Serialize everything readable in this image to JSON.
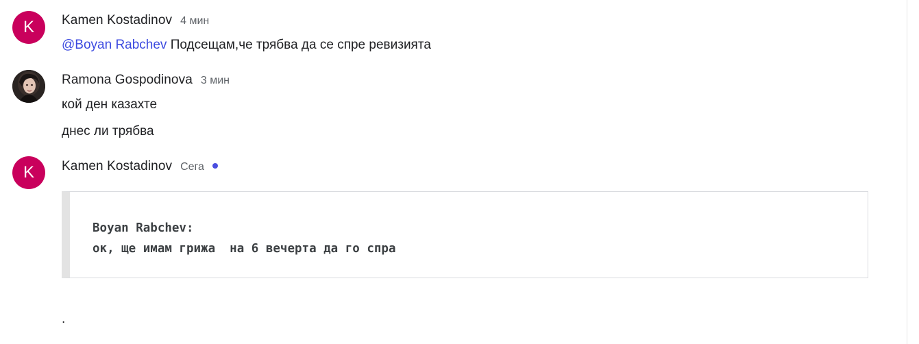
{
  "messages": [
    {
      "sender": "Kamen Kostadinov",
      "time": "4 мин",
      "avatar_letter": "K",
      "avatar_color": "#c9005c",
      "mention": "@Boyan Rabchev",
      "text": " Подсещам,че трябва да се спре ревизията"
    },
    {
      "sender": "Ramona Gospodinova",
      "time": "3 мин",
      "avatar": "profile-photo",
      "lines": [
        "кой ден казахте",
        "днес ли трябва"
      ]
    },
    {
      "sender": "Kamen Kostadinov",
      "time": "Сега",
      "avatar_letter": "K",
      "avatar_color": "#c9005c",
      "unread_dot_color": "#4a4ee0",
      "quote": {
        "line1": "Boyan Rabchev:",
        "line2": "ок, ще имам грижа  на 6 вечерта да го спра"
      },
      "trailing": "."
    }
  ],
  "colors": {
    "mention": "#3c4ae0",
    "avatar": "#c9005c",
    "unread_dot": "#4a4ee0"
  }
}
